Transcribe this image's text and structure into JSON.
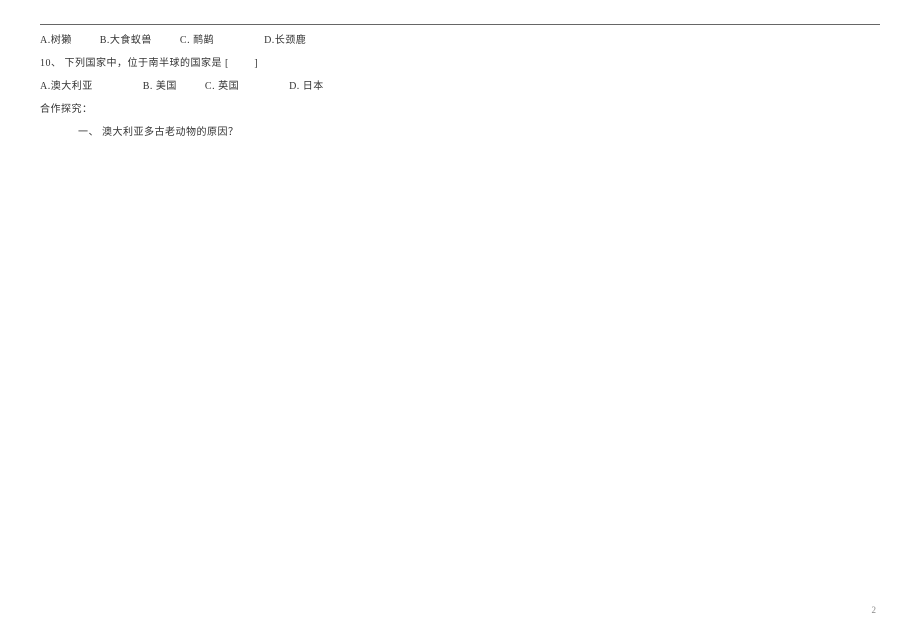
{
  "q9": {
    "options": {
      "a": "A.树獭",
      "b": "B.大食蚁兽",
      "c": "C. 鸸鹋",
      "d": "D.长颈鹿"
    }
  },
  "q10": {
    "number": "10、",
    "text": "下列国家中，位于南半球的国家是",
    "bracket": "[　　]",
    "options": {
      "a": "A.澳大利亚",
      "b": "B. 美国",
      "c": "C. 英国",
      "d": "D. 日本"
    }
  },
  "section": {
    "title": "合作探究：",
    "item1_num": "一、",
    "item1_text": "澳大利亚多古老动物的原因？"
  },
  "page_number": "2"
}
